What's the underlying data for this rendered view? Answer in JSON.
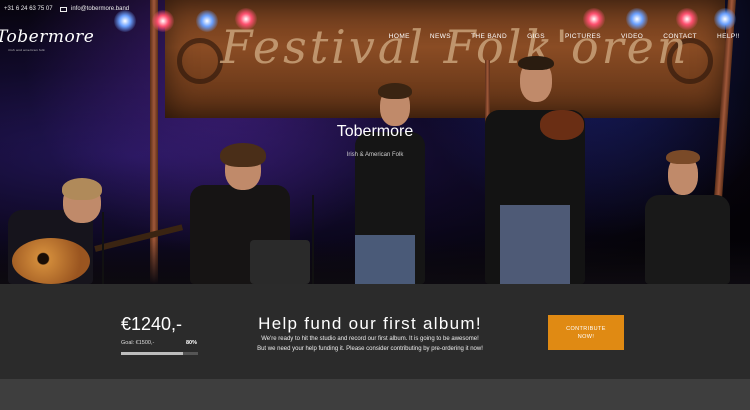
{
  "topbar": {
    "phone": "+31 6 24 63 75 07",
    "email": "info@tobermore.band"
  },
  "logo": {
    "text": "Tobermore",
    "subtitle": "irish and american folk"
  },
  "nav": {
    "items": [
      "HOME",
      "NEWS",
      "THE BAND",
      "GIGS",
      "PICTURES",
      "VIDEO",
      "CONTACT",
      "HELP!!"
    ]
  },
  "hero": {
    "banner_text": "Festival Folk'oren",
    "title": "Tobermore",
    "subtitle": "Irish & American Folk"
  },
  "fund": {
    "amount": "€1240,-",
    "goal_label": "Goal: €1500,-",
    "percent_label": "80%",
    "progress": 0.8,
    "title": "Help fund our first album!",
    "line1": "We're ready to hit the studio and record our first album. It is going to be awesome!",
    "line2": "But we need your help funding it. Please consider contributing by pre-ordering it now!",
    "cta_label": "CONTRIBUTE\nNOW!",
    "cta_color": "#e08a13"
  }
}
